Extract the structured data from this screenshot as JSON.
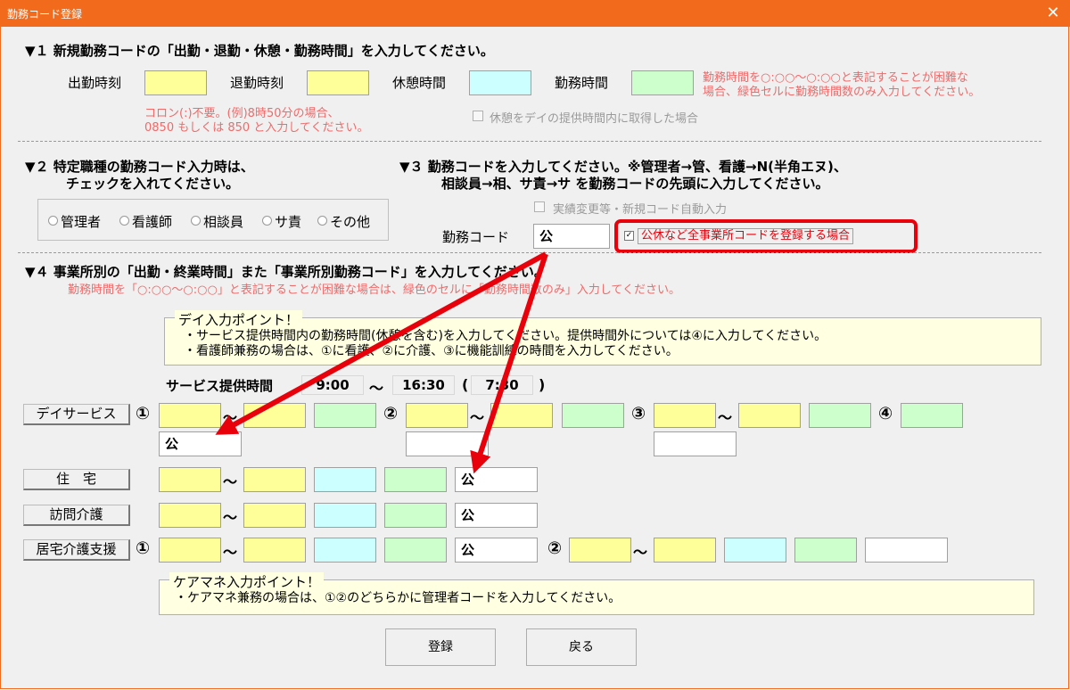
{
  "window": {
    "title": "勤務コード登録",
    "close_label": "✕"
  },
  "section1": {
    "heading": "▼１ 新規勤務コードの「出勤・退勤・休憩・勤務時間」を入力してください。",
    "labels": {
      "start": "出勤時刻",
      "end": "退勤時刻",
      "break": "休憩時間",
      "work": "勤務時間"
    },
    "note_right_1": "勤務時間を○:○○～○:○○と表記することが困難な",
    "note_right_2": "場合、緑色セルに勤務時間数のみ入力してください。",
    "note_left_1": "コロン(:)不要。(例)8時50分の場合、",
    "note_left_2": "0850 もしくは 850 と入力してください。",
    "break_checkbox_label": "休憩をデイの提供時間内に取得した場合"
  },
  "section2": {
    "heading_1": "▼２ 特定職種の勤務コード入力時は、",
    "heading_2": "チェックを入れてください。",
    "options": [
      "管理者",
      "看護師",
      "相談員",
      "サ責",
      "その他"
    ]
  },
  "section3": {
    "heading_1": "▼３ 勤務コードを入力してください。※管理者→管、看護→N(半角エヌ)、",
    "heading_2": "相談員→相、サ責→サ を勤務コードの先頭に入力してください。",
    "auto_checkbox_label": "実績変更等・新規コード自動入力",
    "code_label": "勤務コード",
    "code_value": "公",
    "all_office_checkbox_label": "公休など全事業所コードを登録する場合",
    "all_office_checked_mark": "✓"
  },
  "section4": {
    "heading": "▼４ 事業所別の「出勤・終業時間」また「事業所別勤務コード」を入力してください。",
    "note": "勤務時間を「○:○○～○:○○」と表記することが困難な場合は、緑色のセルに「勤務時間数のみ」入力してください。"
  },
  "day_point": {
    "title": "デイ入力ポイント！",
    "line1": "・サービス提供時間内の勤務時間(休憩を含む)を入力してください。提供時間外については④に入力してください。",
    "line2": "・看護師兼務の場合は、①に看護、②に介護、③に機能訓練の時間を入力してください。"
  },
  "service_time": {
    "label": "サービス提供時間",
    "start": "9:00",
    "tilde": "～",
    "end": "16:30",
    "open_paren": "(",
    "duration": "7:30",
    "close_paren": ")"
  },
  "rows": {
    "day_service": "デイサービス",
    "housing": "住　宅",
    "home_visit": "訪問介護",
    "care_support": "居宅介護支援"
  },
  "markers": {
    "one": "①",
    "two": "②",
    "three": "③",
    "four": "④",
    "tilde": "～"
  },
  "codes": {
    "day1": "公",
    "day2": "",
    "day3": "",
    "housing": "公",
    "home_visit": "公",
    "care1": "公",
    "care2": ""
  },
  "caremane_point": {
    "title": "ケアマネ入力ポイント！",
    "line1": "・ケアマネ兼務の場合は、①②のどちらかに管理者コードを入力してください。"
  },
  "buttons": {
    "register": "登録",
    "back": "戻る"
  },
  "annotation_color": "#e8000b",
  "accent_color": "#f26b1d"
}
